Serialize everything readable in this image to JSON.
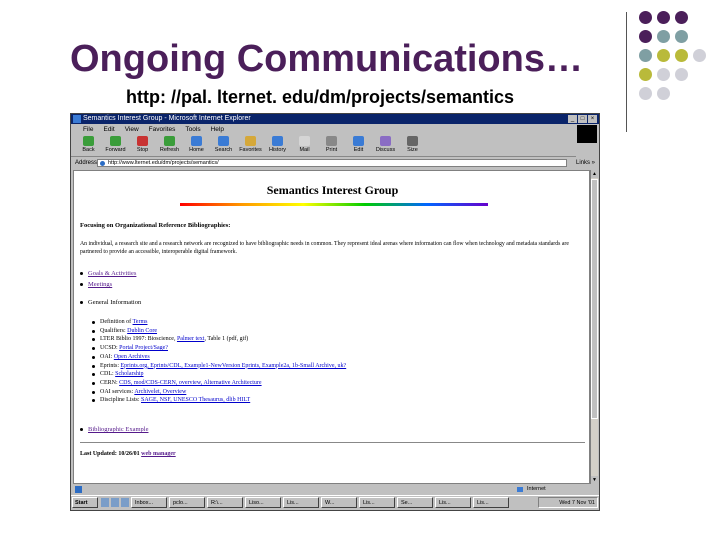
{
  "slide": {
    "title": "Ongoing Communications…",
    "subtitle": "http: //pal. lternet. edu/dm/projects/semantics",
    "decor_colors": [
      "#4b1f5a",
      "#7f9fa3",
      "#b9ba3a",
      "#d0d0d8"
    ]
  },
  "browser": {
    "window_title": "Semantics Interest Group - Microsoft Internet Explorer",
    "window_buttons": [
      "_",
      "□",
      "×"
    ],
    "menu": [
      "File",
      "Edit",
      "View",
      "Favorites",
      "Tools",
      "Help"
    ],
    "toolbar": [
      {
        "label": "Back",
        "icon": "back-arrow-icon"
      },
      {
        "label": "Forward",
        "icon": "forward-arrow-icon"
      },
      {
        "label": "Stop",
        "icon": "stop-icon"
      },
      {
        "label": "Refresh",
        "icon": "refresh-icon"
      },
      {
        "label": "Home",
        "icon": "home-icon"
      },
      {
        "label": "Search",
        "icon": "search-icon"
      },
      {
        "label": "Favorites",
        "icon": "favorites-icon"
      },
      {
        "label": "History",
        "icon": "history-icon"
      },
      {
        "label": "Mail",
        "icon": "mail-icon"
      },
      {
        "label": "Print",
        "icon": "print-icon"
      },
      {
        "label": "Edit",
        "icon": "edit-icon"
      },
      {
        "label": "Discuss",
        "icon": "discuss-icon"
      },
      {
        "label": "Size",
        "icon": "size-icon"
      }
    ],
    "address_label": "Address",
    "address_value": "http://www.lternet.edu/dm/projects/semantics/",
    "links_label": "Links »",
    "status_zone": "Internet"
  },
  "page": {
    "heading": "Semantics Interest Group",
    "focus_title": "Focusing on Organizational Reference Bibliographies:",
    "intro": "An individual, a research site and a research network are recognized to have bibliographic needs in common. They represent ideal arenas where information can flow when technology and metadata standards are partnered to provide an accessible, interoperable digital framework.",
    "top_items": [
      {
        "label": "Goals & Activities"
      },
      {
        "label": "Meetings"
      }
    ],
    "general_info_label": "General Information",
    "general_info": [
      {
        "prefix": "Definition of ",
        "link": "Terms"
      },
      {
        "prefix": "Qualifiers: ",
        "link": "Dublin Core"
      },
      {
        "prefix": "LTER Biblio 1997: Bioscience, ",
        "link": "Palmer text",
        "suffix": ", Table 1 (pdf, gif)"
      },
      {
        "prefix": "UCSD: ",
        "link": "Portal Project/Sage?"
      },
      {
        "prefix": "OAI: ",
        "link": "Open Archives"
      },
      {
        "prefix": "Eprints: ",
        "link": "Eprints.org, Eprints/CDL, Example1-NewVersion Eprints, Example2a, 1b-Small Archive, uk?"
      },
      {
        "prefix": "CDL: ",
        "link": "Scholarship"
      },
      {
        "prefix": "CERN: ",
        "link": "CDS, mod/CDS-CERN, overview, Alternative Architecture"
      },
      {
        "prefix": "OAI services: ",
        "link": "Archivelet, Overview"
      },
      {
        "prefix": "Discipline Lists: ",
        "link": "SAGE, NSF, UNESCO Thesaurus, dlib HILT"
      }
    ],
    "bib_example": "Bibliographic Example",
    "footer_prefix": "Last Updated: 10/26/01 ",
    "footer_link": "web manager"
  },
  "taskbar": {
    "start": "Start",
    "tasks": [
      "Inbox...",
      "pclo...",
      "R:\\...",
      "Liso...",
      "Lis...",
      "W...",
      "Lis...",
      "Se...",
      "Lis...",
      "Lis..."
    ],
    "clock": "Wed 7 Nov '01"
  }
}
